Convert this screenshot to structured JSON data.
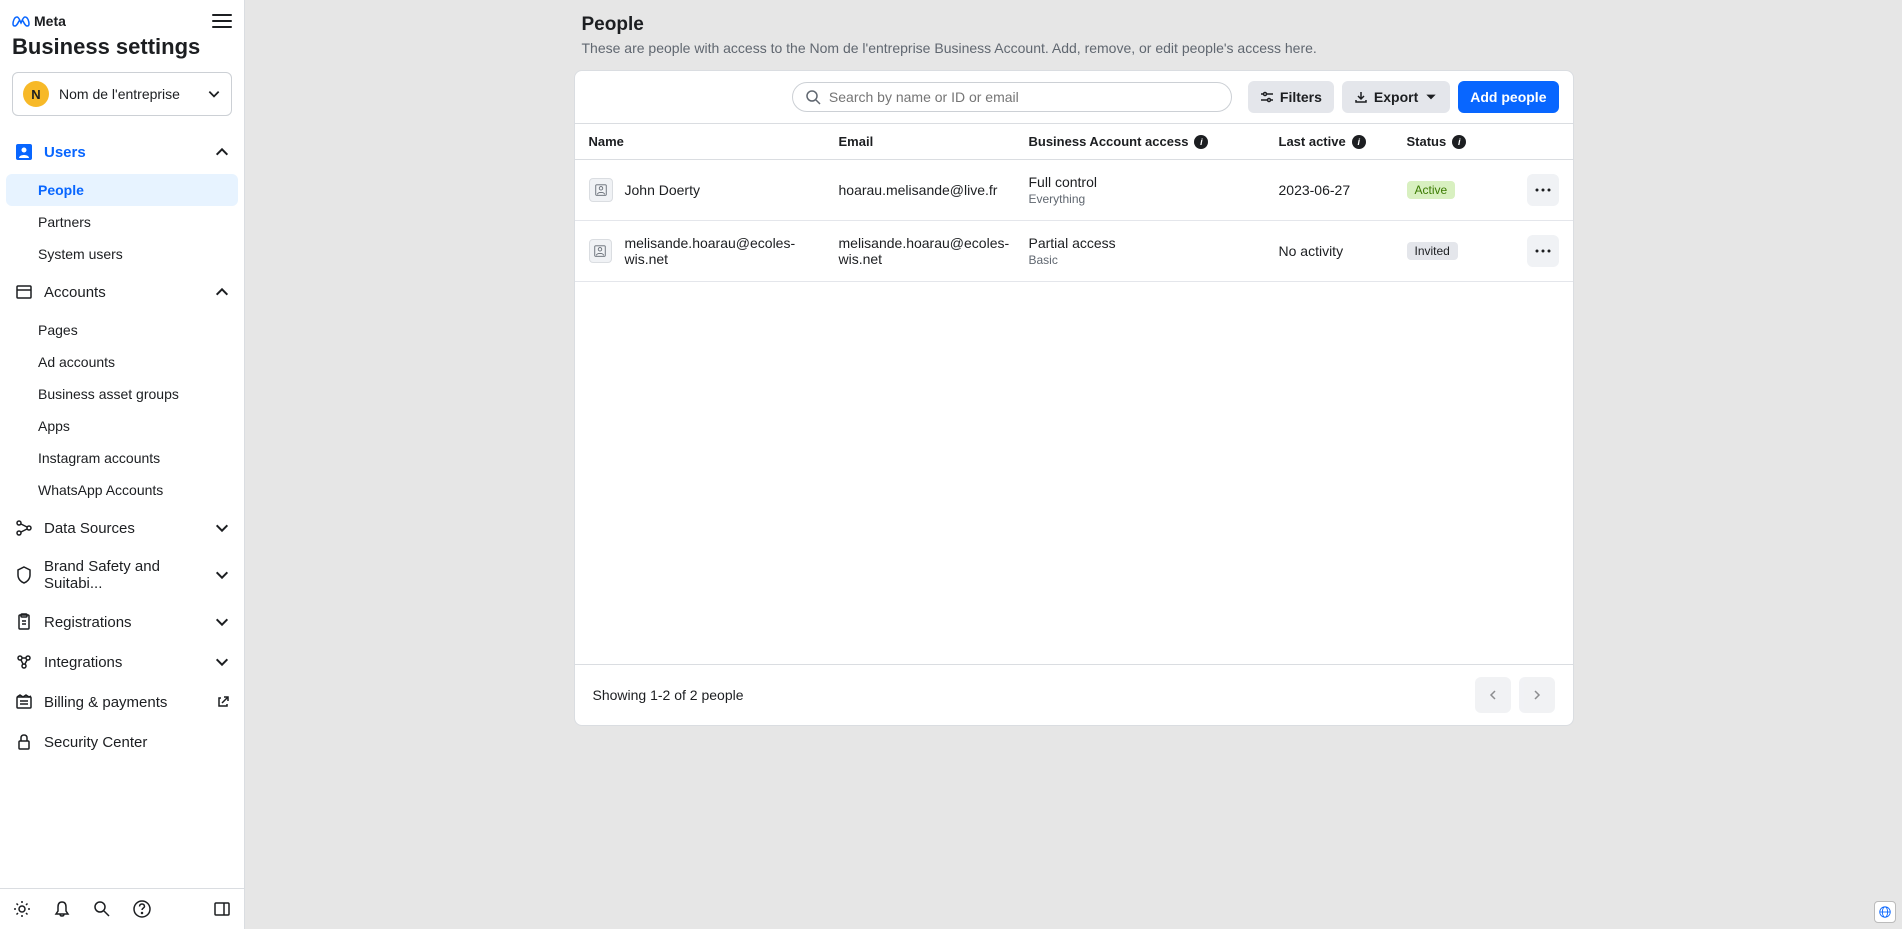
{
  "brand": {
    "name": "Meta"
  },
  "page_title": "Business settings",
  "org": {
    "initial": "N",
    "name": "Nom de l'entreprise"
  },
  "nav": {
    "users": {
      "label": "Users",
      "items": [
        {
          "label": "People"
        },
        {
          "label": "Partners"
        },
        {
          "label": "System users"
        }
      ]
    },
    "accounts": {
      "label": "Accounts",
      "items": [
        {
          "label": "Pages"
        },
        {
          "label": "Ad accounts"
        },
        {
          "label": "Business asset groups"
        },
        {
          "label": "Apps"
        },
        {
          "label": "Instagram accounts"
        },
        {
          "label": "WhatsApp Accounts"
        }
      ]
    },
    "data_sources": {
      "label": "Data Sources"
    },
    "brand_safety": {
      "label": "Brand Safety and Suitabi..."
    },
    "registrations": {
      "label": "Registrations"
    },
    "integrations": {
      "label": "Integrations"
    },
    "billing": {
      "label": "Billing & payments"
    },
    "security": {
      "label": "Security Center"
    }
  },
  "content": {
    "title": "People",
    "subtitle": "These are people with access to the Nom de l'entreprise Business Account. Add, remove, or edit people's access here.",
    "search_placeholder": "Search by name or ID or email",
    "filters_label": "Filters",
    "export_label": "Export",
    "add_label": "Add people",
    "columns": {
      "name": "Name",
      "email": "Email",
      "access": "Business Account access",
      "last_active": "Last active",
      "status": "Status"
    },
    "rows": [
      {
        "name": "John Doerty",
        "email": "hoarau.melisande@live.fr",
        "access": "Full control",
        "access_sub": "Everything",
        "last_active": "2023-06-27",
        "status": "Active",
        "status_class": "status-active"
      },
      {
        "name": "melisande.hoarau@ecoles-wis.net",
        "email": "melisande.hoarau@ecoles-wis.net",
        "access": "Partial access",
        "access_sub": "Basic",
        "last_active": "No activity",
        "status": "Invited",
        "status_class": "status-invited"
      }
    ],
    "footer_text": "Showing 1-2 of 2 people"
  }
}
